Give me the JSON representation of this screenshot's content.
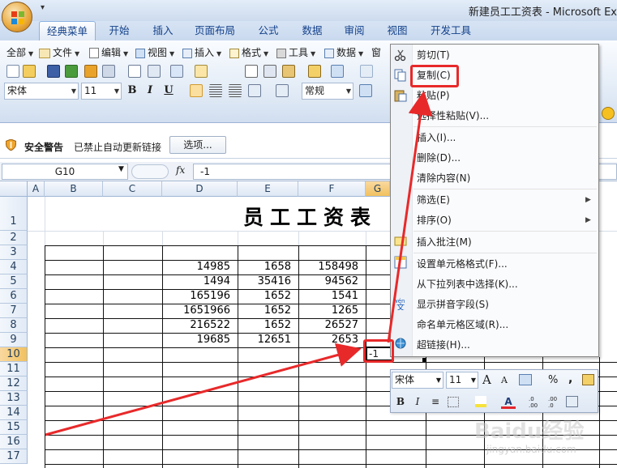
{
  "window": {
    "title": "新建员工工资表 - Microsoft Ex",
    "qat_more": "▾"
  },
  "tabs": [
    {
      "label": "经典菜单"
    },
    {
      "label": "开始"
    },
    {
      "label": "插入"
    },
    {
      "label": "页面布局"
    },
    {
      "label": "公式"
    },
    {
      "label": "数据"
    },
    {
      "label": "审阅"
    },
    {
      "label": "视图"
    },
    {
      "label": "开发工具"
    }
  ],
  "classic_menu": [
    {
      "label": "全部"
    },
    {
      "label": "文件"
    },
    {
      "label": "编辑"
    },
    {
      "label": "视图"
    },
    {
      "label": "插入"
    },
    {
      "label": "格式"
    },
    {
      "label": "工具"
    },
    {
      "label": "数据"
    },
    {
      "label": "窗"
    }
  ],
  "toolbar": {
    "font_name": "宋体",
    "font_size": "11",
    "bold": "B",
    "italic": "I",
    "underline": "U",
    "number_format": "常规"
  },
  "security": {
    "warning_label": "安全警告",
    "message": "已禁止自动更新链接",
    "options_button": "选项..."
  },
  "formula_bar": {
    "name_box": "G10",
    "fx": "fx",
    "value": "-1"
  },
  "columns": [
    "A",
    "B",
    "C",
    "D",
    "E",
    "F",
    "G"
  ],
  "rows": [
    "1",
    "2",
    "3",
    "4",
    "5",
    "6",
    "7",
    "8",
    "9",
    "10",
    "11",
    "12",
    "13",
    "14",
    "15",
    "16",
    "17"
  ],
  "sheet": {
    "title": "员工工资表",
    "data": [
      {
        "row": "4",
        "d": "14985",
        "e": "1658",
        "f": "158498"
      },
      {
        "row": "5",
        "d": "1494",
        "e": "35416",
        "f": "94562"
      },
      {
        "row": "6",
        "d": "165196",
        "e": "1652",
        "f": "1541"
      },
      {
        "row": "7",
        "d": "1651966",
        "e": "1652",
        "f": "1265"
      },
      {
        "row": "8",
        "d": "216522",
        "e": "1652",
        "f": "26527"
      },
      {
        "row": "9",
        "d": "19685",
        "e": "12651",
        "f": "2653"
      }
    ],
    "active_cell_value": "-1"
  },
  "context_menu": [
    {
      "label": "剪切(T)",
      "icon": "scissors-icon"
    },
    {
      "label": "复制(C)",
      "icon": "copy-icon"
    },
    {
      "label": "粘贴(P)",
      "icon": "paste-icon"
    },
    {
      "label": "选择性粘贴(V)..."
    },
    {
      "label": "插入(I)..."
    },
    {
      "label": "删除(D)..."
    },
    {
      "label": "清除内容(N)"
    },
    {
      "label": "筛选(E)",
      "submenu": "▶"
    },
    {
      "label": "排序(O)",
      "submenu": "▶"
    },
    {
      "label": "插入批注(M)",
      "icon": "comment-icon"
    },
    {
      "label": "设置单元格格式(F)...",
      "icon": "format-cells-icon"
    },
    {
      "label": "从下拉列表中选择(K)..."
    },
    {
      "label": "显示拼音字段(S)",
      "icon": "phonetic-icon"
    },
    {
      "label": "命名单元格区域(R)..."
    },
    {
      "label": "超链接(H)...",
      "icon": "hyperlink-icon"
    }
  ],
  "mini_toolbar": {
    "font_name": "宋体",
    "font_size": "11",
    "grow": "A",
    "shrink": "A",
    "percent": "%",
    "comma": ",",
    "bold": "B",
    "italic": "I",
    "center": "≡",
    "font_color": "A",
    "inc_decimal": ".0\n.00",
    "dec_decimal": ".00\n.0"
  },
  "watermark": {
    "text": "Baidu经验",
    "sub": "jingyan.baidu.com"
  },
  "colors": {
    "accent": "#15428b",
    "annotation": "#e8292a",
    "selected_header": "#f1c15f"
  }
}
